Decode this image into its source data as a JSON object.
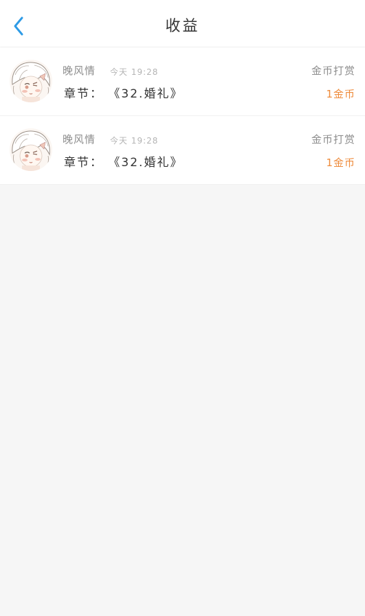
{
  "header": {
    "title": "收益",
    "back_icon": "chevron-left-icon"
  },
  "colors": {
    "accent_blue": "#2e9be6",
    "amount_orange": "#ee8a3a",
    "background": "#f6f6f6"
  },
  "records": [
    {
      "avatar_icon": "user-avatar-anime-icon",
      "name": "晚风情",
      "time": "今天 19:28",
      "chapter": "章节： 《32.婚礼》",
      "kind": "金币打赏",
      "amount": "1金币"
    },
    {
      "avatar_icon": "user-avatar-anime-icon",
      "name": "晚风情",
      "time": "今天 19:28",
      "chapter": "章节： 《32.婚礼》",
      "kind": "金币打赏",
      "amount": "1金币"
    }
  ]
}
